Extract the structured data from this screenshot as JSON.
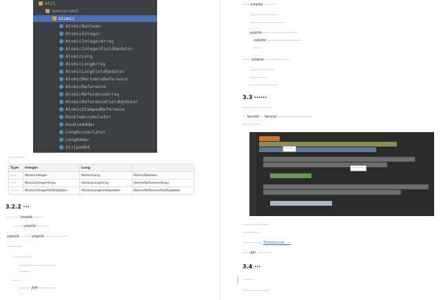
{
  "tree": {
    "items": [
      {
        "label": "util",
        "indent": 0,
        "kind": "folder"
      },
      {
        "label": "concurrent",
        "indent": 1,
        "kind": "folder"
      },
      {
        "label": "atomic",
        "indent": 2,
        "kind": "folder",
        "selected": true
      },
      {
        "label": "AtomicBoolean",
        "indent": 3,
        "kind": "class"
      },
      {
        "label": "AtomicInteger",
        "indent": 3,
        "kind": "class"
      },
      {
        "label": "AtomicIntegerArray",
        "indent": 3,
        "kind": "class"
      },
      {
        "label": "AtomicIntegerFieldUpdater",
        "indent": 3,
        "kind": "class"
      },
      {
        "label": "AtomicLong",
        "indent": 3,
        "kind": "class"
      },
      {
        "label": "AtomicLongArray",
        "indent": 3,
        "kind": "class"
      },
      {
        "label": "AtomicLongFieldUpdater",
        "indent": 3,
        "kind": "class"
      },
      {
        "label": "AtomicMarkableReference",
        "indent": 3,
        "kind": "class"
      },
      {
        "label": "AtomicReference",
        "indent": 3,
        "kind": "class"
      },
      {
        "label": "AtomicReferenceArray",
        "indent": 3,
        "kind": "class"
      },
      {
        "label": "AtomicReferenceFieldUpdater",
        "indent": 3,
        "kind": "class"
      },
      {
        "label": "AtomicStampedReference",
        "indent": 3,
        "kind": "class"
      },
      {
        "label": "DoubleAccumulator",
        "indent": 3,
        "kind": "class"
      },
      {
        "label": "DoubleAdder",
        "indent": 3,
        "kind": "class"
      },
      {
        "label": "LongAccumulator",
        "indent": 3,
        "kind": "class"
      },
      {
        "label": "LongAdder",
        "indent": 3,
        "kind": "class"
      },
      {
        "label": "Striped64",
        "indent": 3,
        "kind": "class"
      }
    ]
  },
  "left": {
    "intro": "···············",
    "table": {
      "headers": [
        "Type",
        "Integer",
        "Long",
        ""
      ],
      "rows": [
        [
          "······",
          "AtomicInteger",
          "AtomicLong",
          "AtomicBoolean"
        ],
        [
          "······",
          "AtomicIntegerArray",
          "AtomicLongArray",
          "AtomicReferenceArray"
        ],
        [
          "········",
          "AtomicIntegerFieldUpdater",
          "AtomicLongFieldUpdater",
          "AtomicReferenceFieldUpdater"
        ]
      ]
    },
    "section_322": "3.2.2 ···",
    "p1": "··········· volatile ········",
    "b1": "········· volatile ···········",
    "p2": "volatile ········· volatile ·····················",
    "p3": "··············",
    "b2": "··················",
    "b2a": "·································",
    "b2b": "··········",
    "b3": "········",
    "b3a": "·········· JVM ················",
    "b3b": "··"
  },
  "right": {
    "p_top": "······ volatile ···········",
    "bullets_top": [
      "··························",
      "·······························",
      "volatile ·······························",
      "volatile ·······························",
      "·······"
    ],
    "p_mid": "······· volatile ······················",
    "bullets_mid": [
      "·······················",
      "················",
      "··························"
    ],
    "h33": "3.3 ······",
    "p33a": "··························",
    "p33b": "··· Servlet ··· Servlet ·······························",
    "p33c": "················",
    "tip1": "········",
    "tip2": "···········",
    "p_after1": "························",
    "p_after2": "···············",
    "p_after3": "··················",
    "link": "ThreadLocal ·····",
    "p_after4": "······ API ··············",
    "h34": "3.4 ···",
    "quote": "··········",
    "p34": "························"
  }
}
